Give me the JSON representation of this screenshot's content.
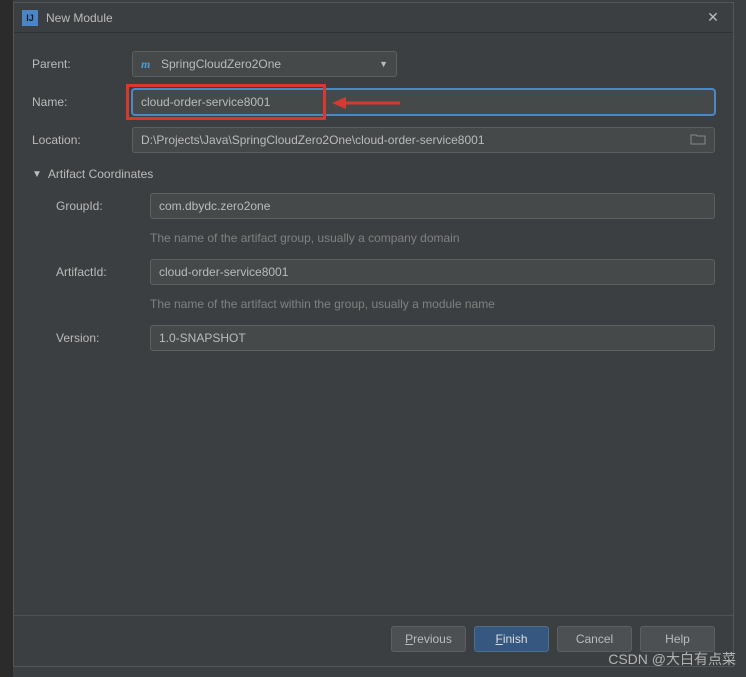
{
  "dialog": {
    "title": "New Module"
  },
  "form": {
    "parent_label": "Parent:",
    "parent_value": "SpringCloudZero2One",
    "name_label": "Name:",
    "name_value": "cloud-order-service8001",
    "location_label": "Location:",
    "location_value": "D:\\Projects\\Java\\SpringCloudZero2One\\cloud-order-service8001"
  },
  "artifact": {
    "section_title": "Artifact Coordinates",
    "groupid_label": "GroupId:",
    "groupid_value": "com.dbydc.zero2one",
    "groupid_hint": "The name of the artifact group, usually a company domain",
    "artifactid_label": "ArtifactId:",
    "artifactid_value": "cloud-order-service8001",
    "artifactid_hint": "The name of the artifact within the group, usually a module name",
    "version_label": "Version:",
    "version_value": "1.0-SNAPSHOT"
  },
  "buttons": {
    "previous": "Previous",
    "finish": "Finish",
    "cancel": "Cancel",
    "help": "Help"
  },
  "watermark": "CSDN @大白有点菜"
}
